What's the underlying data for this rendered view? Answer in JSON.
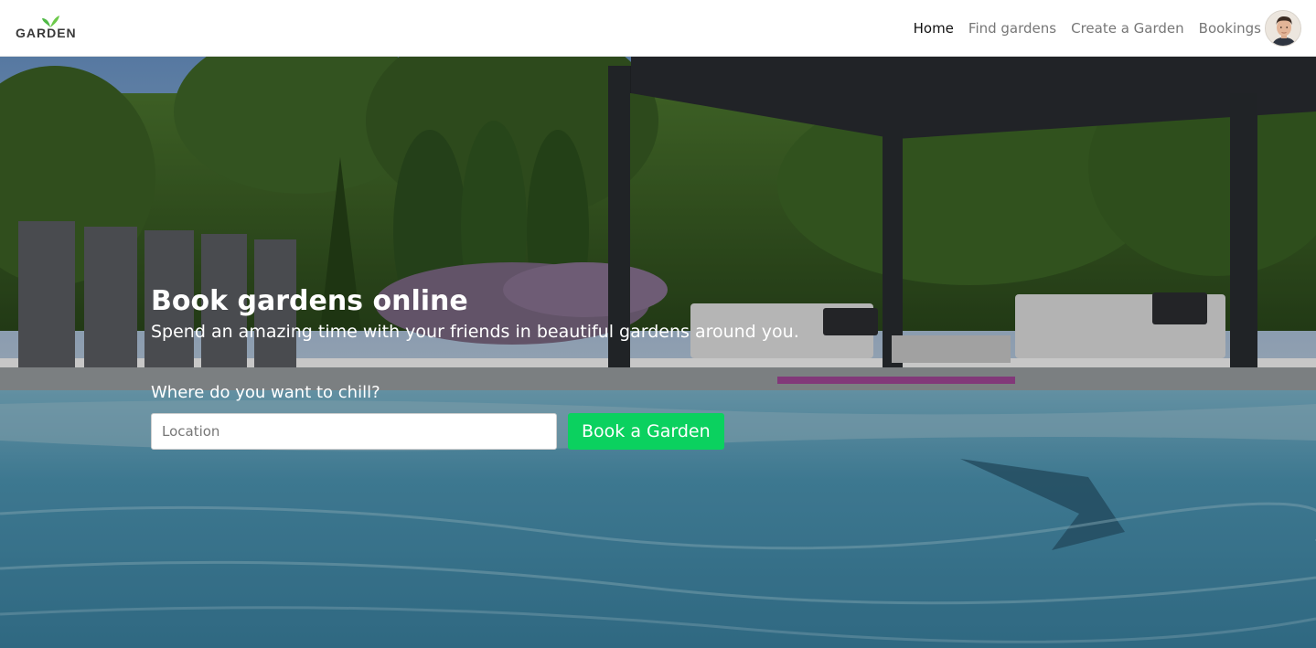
{
  "brand": {
    "logo_text": "GARDEN",
    "logo_icon": "leaf-icon"
  },
  "nav": {
    "items": [
      {
        "label": "Home",
        "active": true
      },
      {
        "label": "Find gardens",
        "active": false
      },
      {
        "label": "Create a Garden",
        "active": false
      },
      {
        "label": "Bookings",
        "active": false
      }
    ],
    "avatar_icon": "user-avatar"
  },
  "hero": {
    "title": "Book gardens online",
    "subtitle": "Spend an amazing time with your friends in beautiful gardens around you.",
    "search_label": "Where do you want to chill?",
    "search_placeholder": "Location",
    "search_value": "",
    "button_label": "Book a Garden",
    "background": "garden-pool-photo"
  },
  "colors": {
    "accent": "#0bd15f",
    "nav_active": "#111111",
    "nav_inactive": "#777777",
    "hero_text": "#ffffff"
  }
}
